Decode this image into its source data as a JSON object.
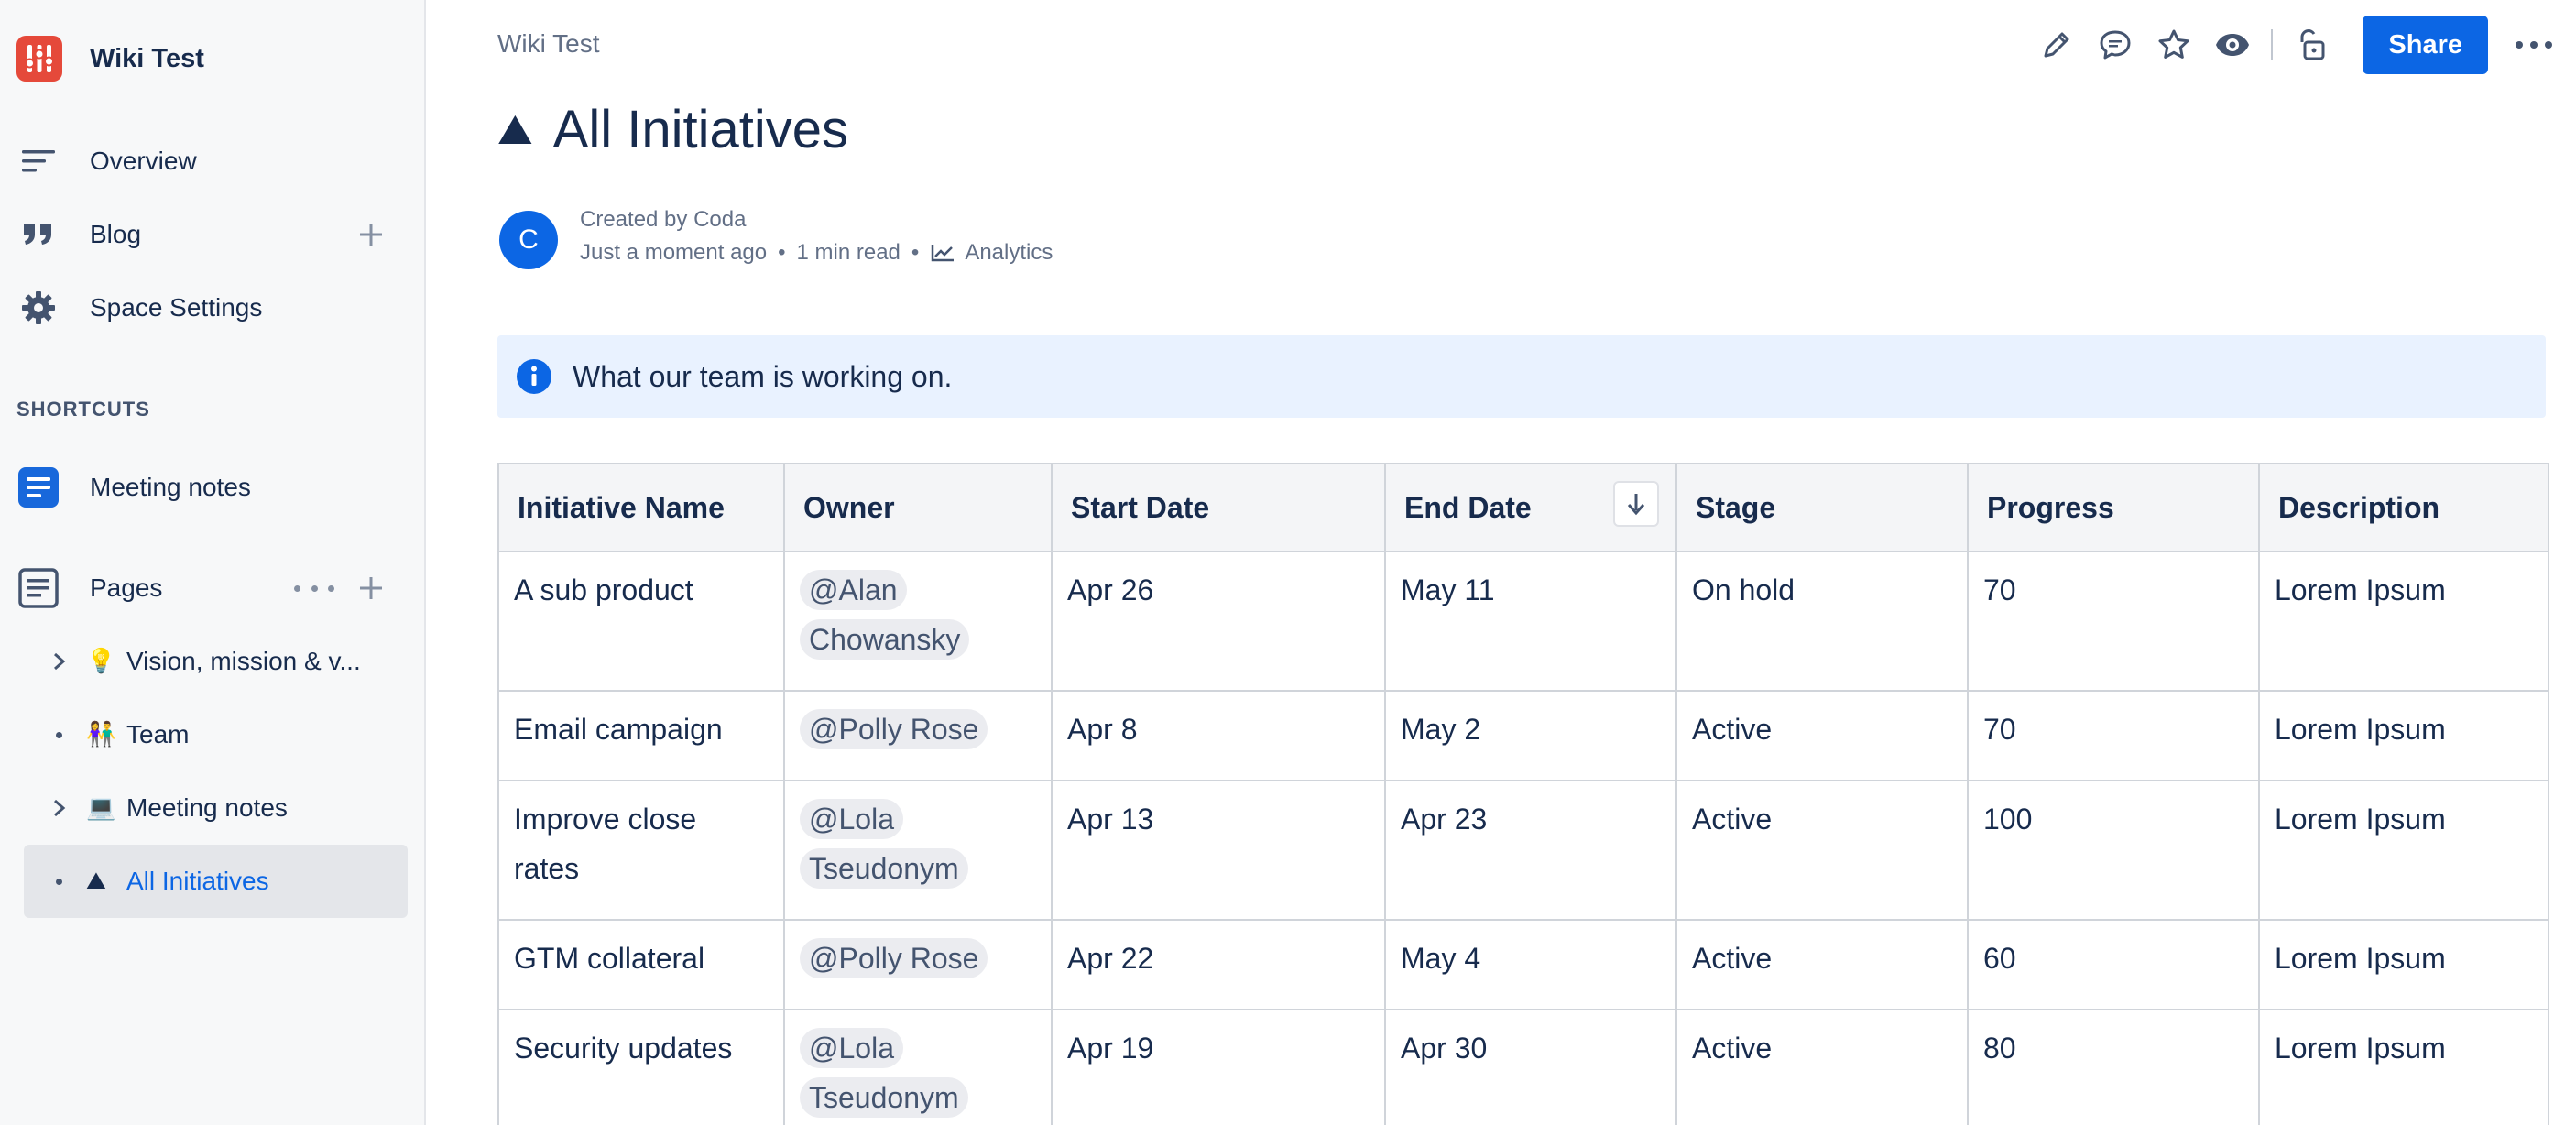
{
  "sidebar": {
    "space_name": "Wiki Test",
    "nav": [
      {
        "label": "Overview",
        "icon": "overview-icon"
      },
      {
        "label": "Blog",
        "icon": "quote-icon"
      },
      {
        "label": "Space Settings",
        "icon": "gear-icon"
      }
    ],
    "shortcuts_heading": "SHORTCUTS",
    "shortcuts": [
      {
        "label": "Meeting notes",
        "icon": "document-icon"
      }
    ],
    "pages_label": "Pages",
    "tree": [
      {
        "label": "Vision, mission & v...",
        "emoji": "💡",
        "expandable": true
      },
      {
        "label": "Team",
        "emoji": "👫",
        "expandable": false
      },
      {
        "label": "Meeting notes",
        "emoji": "💻",
        "expandable": true
      },
      {
        "label": "All Initiatives",
        "emoji": "⛰",
        "expandable": false,
        "selected": true
      }
    ]
  },
  "header": {
    "breadcrumb": "Wiki Test",
    "share_label": "Share"
  },
  "page": {
    "title_emoji": "⛰",
    "title": "All Initiatives",
    "avatar_initial": "C",
    "created_by": "Created by Coda",
    "timestamp": "Just a moment ago",
    "read_time": "1 min read",
    "analytics_label": "Analytics",
    "info_text": "What our team is working on."
  },
  "table": {
    "columns": [
      "Initiative Name",
      "Owner",
      "Start Date",
      "End Date",
      "Stage",
      "Progress",
      "Description"
    ],
    "sorted_column": "End Date",
    "rows": [
      {
        "name": "A sub product",
        "owner": "@Alan Chowansky",
        "start": "Apr 26",
        "end": "May 11",
        "stage": "On hold",
        "progress": "70",
        "description": "Lorem Ipsum"
      },
      {
        "name": "Email campaign",
        "owner": "@Polly Rose",
        "start": "Apr 8",
        "end": "May 2",
        "stage": "Active",
        "progress": "70",
        "description": "Lorem Ipsum"
      },
      {
        "name": "Improve close rates",
        "owner": "@Lola Tseudonym",
        "start": "Apr 13",
        "end": "Apr 23",
        "stage": "Active",
        "progress": "100",
        "description": "Lorem Ipsum"
      },
      {
        "name": "GTM collateral",
        "owner": "@Polly Rose",
        "start": "Apr 22",
        "end": "May 4",
        "stage": "Active",
        "progress": "60",
        "description": "Lorem Ipsum"
      },
      {
        "name": "Security updates",
        "owner": "@Lola Tseudonym",
        "start": "Apr 19",
        "end": "Apr 30",
        "stage": "Active",
        "progress": "80",
        "description": "Lorem Ipsum"
      }
    ]
  },
  "colors": {
    "accent": "#0c66e4",
    "space_logo": "#e5493a",
    "info_panel": "#e9f2ff"
  }
}
